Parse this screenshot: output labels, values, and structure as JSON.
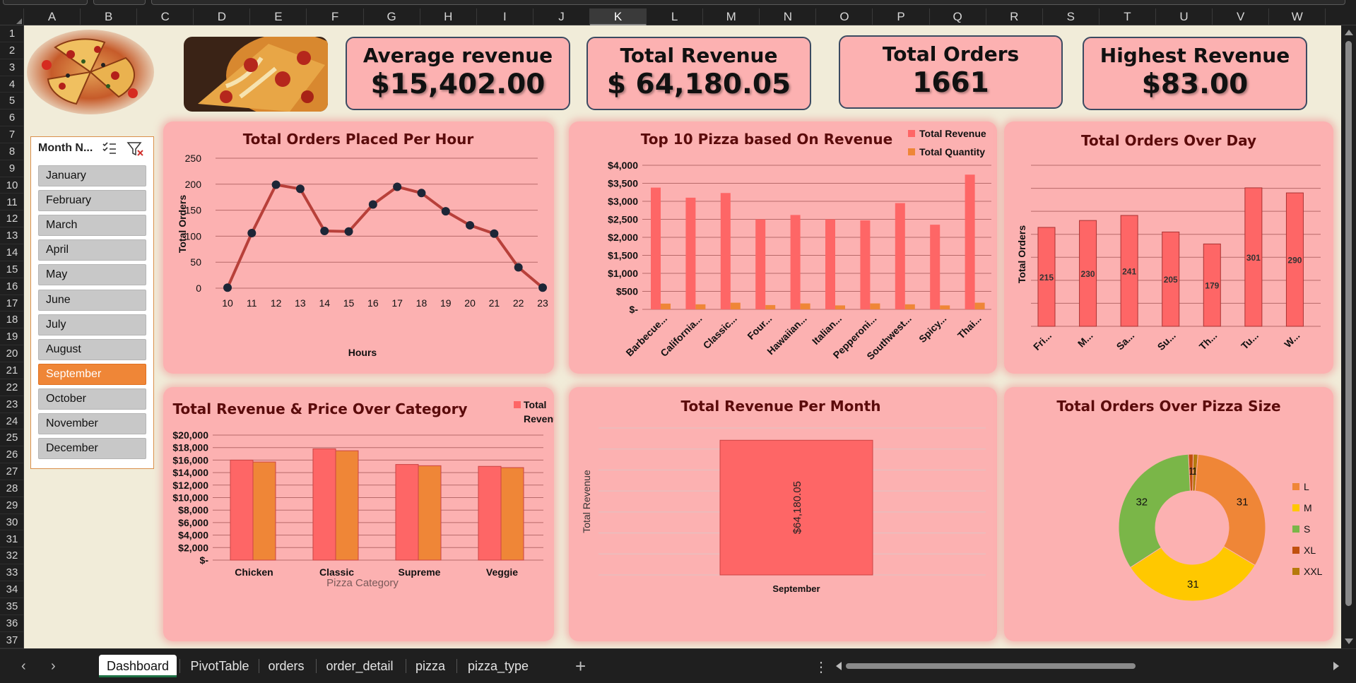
{
  "columns": [
    "A",
    "B",
    "C",
    "D",
    "E",
    "F",
    "G",
    "H",
    "I",
    "J",
    "K",
    "L",
    "M",
    "N",
    "O",
    "P",
    "Q",
    "R",
    "S",
    "T",
    "U",
    "V",
    "W"
  ],
  "selected_column": "K",
  "rows": [
    "1",
    "2",
    "3",
    "4",
    "5",
    "6",
    "7",
    "8",
    "9",
    "10",
    "11",
    "12",
    "13",
    "14",
    "15",
    "16",
    "17",
    "18",
    "19",
    "20",
    "21",
    "22",
    "23",
    "24",
    "25",
    "26",
    "27",
    "28",
    "29",
    "30",
    "31",
    "32",
    "33",
    "34",
    "35",
    "36",
    "37"
  ],
  "kpis": [
    {
      "title": "Average revenue",
      "value": "$15,402.00"
    },
    {
      "title": "Total Revenue",
      "value": "$ 64,180.05"
    },
    {
      "title": "Total Orders",
      "value": "1661"
    },
    {
      "title": "Highest Revenue",
      "value": "$83.00"
    }
  ],
  "slicer": {
    "title": "Month N...",
    "selected": "September",
    "items": [
      "January",
      "February",
      "March",
      "April",
      "May",
      "June",
      "July",
      "August",
      "September",
      "October",
      "November",
      "December"
    ]
  },
  "colors": {
    "panel_bg": "#fcb1b1",
    "sheet_bg": "#f1ecd9",
    "bar_red": "#fe6666",
    "bar_orange": "#ef8637",
    "line": "#b8403a",
    "marker": "#1d2637",
    "title_text": "#5b0b0b",
    "kpi_border": "#3b4a61",
    "slicer_selected": "#ef8637",
    "pie_L": "#ef8637",
    "pie_M": "#ffc800",
    "pie_S": "#7ab648",
    "pie_XL": "#c0500f",
    "pie_XXL": "#b57a0c"
  },
  "chart_data": [
    {
      "type": "line",
      "title": "Total Orders Placed Per Hour",
      "xlabel": "Hours",
      "ylabel": "Total Orders",
      "x": [
        "10",
        "11",
        "12",
        "13",
        "14",
        "15",
        "16",
        "17",
        "18",
        "19",
        "20",
        "21",
        "22",
        "23"
      ],
      "values": [
        1,
        106,
        199,
        191,
        110,
        109,
        161,
        195,
        183,
        148,
        121,
        105,
        40,
        1
      ],
      "yticks": [
        "0",
        "50",
        "100",
        "150",
        "200",
        "250"
      ],
      "ylim": [
        0,
        250
      ],
      "grid": true,
      "markers": true
    },
    {
      "type": "bar",
      "title": "Top 10 Pizza based On Revenue",
      "categories": [
        "Barbecue...",
        "California...",
        "Classic...",
        "Four...",
        "Hawaiian...",
        "Italian...",
        "Pepperoni...",
        "Southwest...",
        "Spicy...",
        "Thai..."
      ],
      "series": [
        {
          "name": "Total Revenue",
          "values": [
            3380,
            3100,
            3230,
            2500,
            2620,
            2500,
            2470,
            2950,
            2350,
            3740
          ]
        },
        {
          "name": "Total Quantity",
          "values": [
            160,
            140,
            185,
            120,
            165,
            110,
            165,
            140,
            110,
            185
          ]
        }
      ],
      "yticks": [
        "$-",
        "$500",
        "$1,000",
        "$1,500",
        "$2,000",
        "$2,500",
        "$3,000",
        "$3,500",
        "$4,000"
      ],
      "ylim": [
        0,
        4000
      ],
      "legend": "top-right",
      "grid": true
    },
    {
      "type": "bar",
      "title": "Total Orders Over Day",
      "ylabel": "Total Orders",
      "categories": [
        "Fri...",
        "M...",
        "Sa...",
        "Su...",
        "Th...",
        "Tu...",
        "W..."
      ],
      "values": [
        215,
        230,
        241,
        205,
        179,
        301,
        290
      ],
      "data_labels": [
        "215",
        "230",
        "241",
        "205",
        "179",
        "301",
        "290"
      ],
      "ylim": [
        0,
        350
      ],
      "grid": true
    },
    {
      "type": "bar",
      "title": "Total Revenue & Price Over Category",
      "xlabel": "Pizza Category",
      "categories": [
        "Chicken",
        "Classic",
        "Supreme",
        "Veggie"
      ],
      "series": [
        {
          "name": "Total Revenue",
          "values": [
            16000,
            17800,
            15300,
            15000
          ]
        },
        {
          "values": [
            15700,
            17500,
            15100,
            14800
          ]
        }
      ],
      "yticks": [
        "$-",
        "$2,000",
        "$4,000",
        "$6,000",
        "$8,000",
        "$10,000",
        "$12,000",
        "$14,000",
        "$16,000",
        "$18,000",
        "$20,000"
      ],
      "ylim": [
        0,
        20000
      ],
      "legend": "top-right",
      "legend_label_lines": [
        "Total",
        "Revenue"
      ],
      "grid": true
    },
    {
      "type": "bar",
      "title": "Total Revenue Per Month",
      "ylabel": "Total Revenue",
      "categories": [
        "September"
      ],
      "values": [
        64180.05
      ],
      "data_labels": [
        "$64,180.05"
      ],
      "ylim": [
        0,
        70000
      ],
      "grid": true
    },
    {
      "type": "pie",
      "title": "Total Orders Over Pizza Size",
      "donut": true,
      "categories": [
        "L",
        "M",
        "S",
        "XL",
        "XXL"
      ],
      "values": [
        31,
        31,
        32,
        1,
        1
      ],
      "data_labels": [
        "31",
        "31",
        "32",
        "1",
        "1"
      ],
      "legend": "right"
    }
  ],
  "sheet_tabs": {
    "active": "Dashboard",
    "tabs": [
      "Dashboard",
      "PivotTable",
      "orders",
      "order_detail",
      "pizza",
      "pizza_type"
    ],
    "add_label": "+",
    "prev_label": "‹",
    "next_label": "›",
    "more_label": "⋮"
  }
}
